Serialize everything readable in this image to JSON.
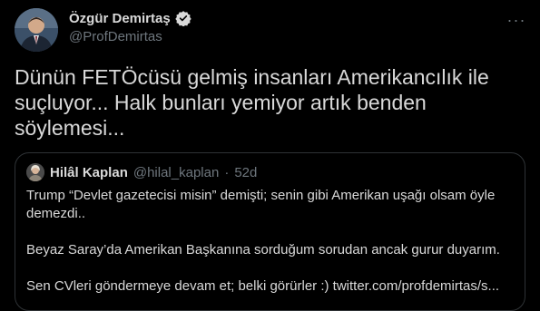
{
  "tweet": {
    "author_name": "Özgür Demirtaş",
    "author_handle": "@ProfDemirtas",
    "more_label": "···",
    "text": "Dünün FETÖcüsü gelmiş insanları Amerikancılık ile\nsuçluyor... Halk bunları yemiyor artık benden\nsöylemesi..."
  },
  "quote": {
    "author_name": "Hilâl Kaplan",
    "author_handle": "@hilal_kaplan",
    "separator": "·",
    "time": "52d",
    "text": "Trump “Devlet gazetecisi misin” demişti; senin gibi Amerikan uşağı olsam öyle\ndemezdi..\n\nBeyaz Saray’da Amerikan Başkanına sorduğum sorudan ancak gurur duyarım.\n\nSen CVleri göndermeye devam et; belki görürler :) twitter.com/profdemirtas/s..."
  },
  "colors": {
    "background": "#000000",
    "text": "#d9d9d9",
    "secondary": "#6e767d",
    "verified": "#d9d9d9",
    "border": "#2f3336"
  }
}
